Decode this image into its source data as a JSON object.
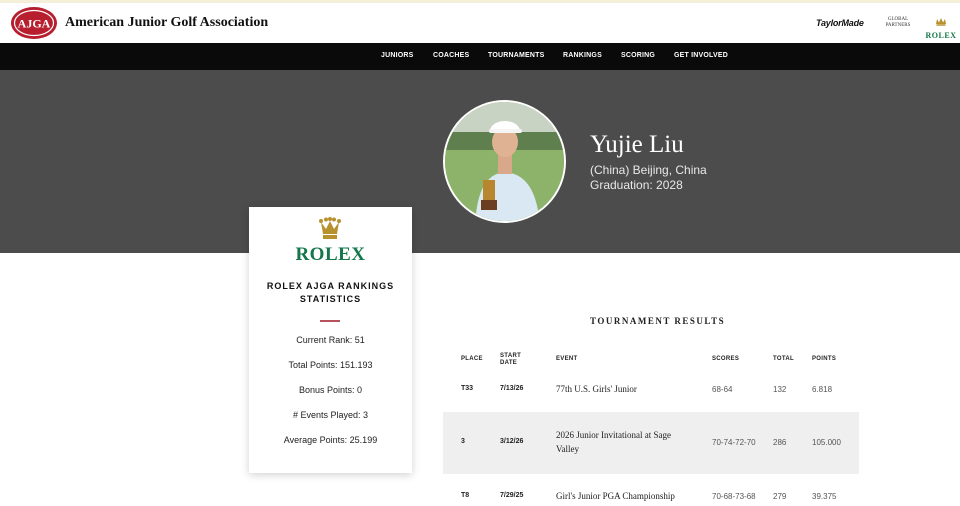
{
  "header": {
    "logo_text": "AJGA",
    "brand": "American Junior Golf Association",
    "sponsors": {
      "taylormade": "TaylorMade",
      "global_partners": "GLOBAL PARTNERS",
      "rolex": "ROLEX"
    }
  },
  "nav": {
    "items": [
      "JUNIORS",
      "COACHES",
      "TOURNAMENTS",
      "RANKINGS",
      "SCORING",
      "GET INVOLVED"
    ]
  },
  "player": {
    "name": "Yujie Liu",
    "location": "(China) Beijing, China",
    "graduation": "Graduation: 2028"
  },
  "stats_card": {
    "brand": "ROLEX",
    "title": "ROLEX AJGA RANKINGS STATISTICS",
    "items": [
      "Current Rank: 51",
      "Total Points: 151.193",
      "Bonus Points: 0",
      "# Events Played: 3",
      "Average Points: 25.199"
    ]
  },
  "results": {
    "title": "TOURNAMENT RESULTS",
    "columns": {
      "place": "PLACE",
      "start_date_1": "START",
      "start_date_2": "DATE",
      "event": "EVENT",
      "scores": "SCORES",
      "total": "TOTAL",
      "points": "POINTS"
    },
    "rows": [
      {
        "place": "T33",
        "date": "7/13/26",
        "event_1": "77th U.S. Girls' Junior",
        "event_2": "",
        "scores": "68-64",
        "total": "132",
        "points": "6.818"
      },
      {
        "place": "3",
        "date": "3/12/26",
        "event_1": "2026 Junior Invitational at Sage",
        "event_2": "Valley",
        "scores": "70-74-72-70",
        "total": "286",
        "points": "105.000"
      },
      {
        "place": "T8",
        "date": "7/29/25",
        "event_1": "Girl's Junior PGA Championship",
        "event_2": "",
        "scores": "70-68-73-68",
        "total": "279",
        "points": "39.375"
      }
    ]
  },
  "colors": {
    "rolex_green": "#127749",
    "hero_gray": "#4c4c4c",
    "nav_black": "#0a0a0a",
    "logo_red": "#b71f2f",
    "accent_rule": "#b5525d"
  }
}
